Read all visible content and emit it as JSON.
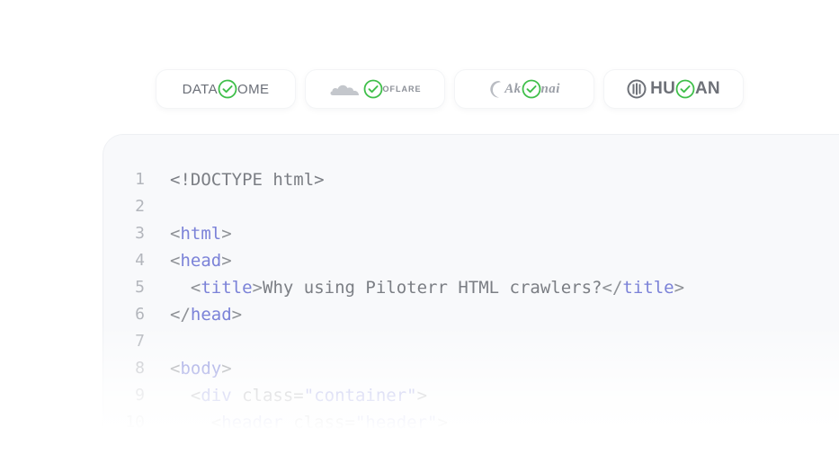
{
  "logos": [
    {
      "name": "DataDome",
      "parts": [
        "DATA",
        "OME"
      ]
    },
    {
      "name": "Cloudflare",
      "parts": [
        "",
        "OFLARE"
      ]
    },
    {
      "name": "Akamai",
      "parts": [
        "Ak",
        "nai"
      ]
    },
    {
      "name": "Human",
      "parts": [
        "HU",
        "AN"
      ]
    }
  ],
  "colors": {
    "check": "#3fbf4a",
    "tag": "#7b82d8",
    "text": "#7b7e84",
    "line_number": "#b3b6bc",
    "panel": "#f8f9fb"
  },
  "code": {
    "line_numbers": [
      "1",
      "2",
      "3",
      "4",
      "5",
      "6",
      "7",
      "8",
      "9",
      "10"
    ],
    "l1": "<!DOCTYPE html>",
    "l3_open": "<",
    "l3_tag": "html",
    "l3_close": ">",
    "l4_open": "<",
    "l4_tag": "head",
    "l4_close": ">",
    "l5_indent": "  ",
    "l5_open": "<",
    "l5_tag": "title",
    "l5_close": ">",
    "l5_text": "Why using Piloterr HTML crawlers?",
    "l5_end_open": "</",
    "l5_end_tag": "title",
    "l5_end_close": ">",
    "l6_open": "</",
    "l6_tag": "head",
    "l6_close": ">",
    "l8_open": "<",
    "l8_tag": "body",
    "l8_close": ">",
    "l9_indent": "  ",
    "l9_open": "<",
    "l9_tag": "div",
    "l9_attr": " class=",
    "l9_val": "\"container\"",
    "l9_close": ">",
    "l10_indent": "    ",
    "l10_open": "<",
    "l10_tag": "header",
    "l10_attr": " class=",
    "l10_val": "\"header\"",
    "l10_close": ">"
  }
}
